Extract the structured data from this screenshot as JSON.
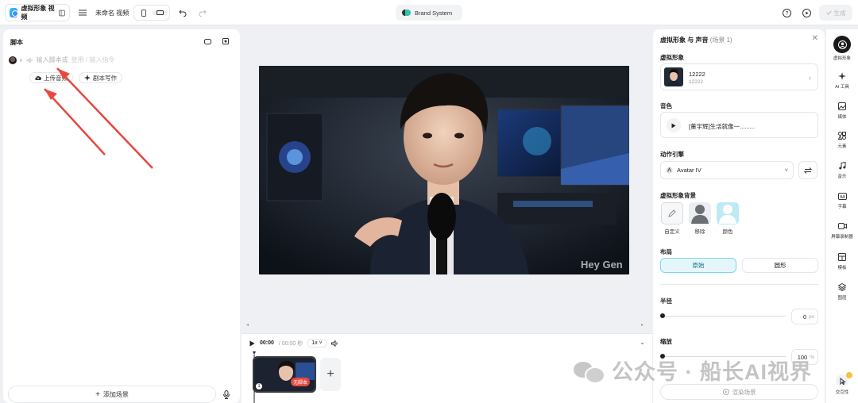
{
  "topbar": {
    "app_name": "虚拟形象 视频",
    "project_name": "未命名 视频",
    "brand_label": "Brand System",
    "publish_label": "生成"
  },
  "script": {
    "title": "脚本",
    "placeholder": "输入脚本或",
    "hint": "使用 / 输入指令",
    "upload_audio": "上传音频",
    "ai_write": "剧本写作",
    "add_scene": "添加场景"
  },
  "video": {
    "watermark": "Hey Gen"
  },
  "timeline": {
    "current_time": "00:00",
    "total_time": "/ 00:00 秒",
    "speed": "1x",
    "clip_badge": "无脚本",
    "clip_index": "1"
  },
  "panel": {
    "title": "虚拟形象 与 声音",
    "scene": "(场景 1)",
    "avatar_section": "虚拟形象",
    "avatar_name": "12222",
    "avatar_sub": "12222",
    "voice_section": "音色",
    "voice_name": "[董宇辉]生活就像一.........",
    "engine_section": "动作引擎",
    "engine_value": "Avatar IV",
    "background_section": "虚拟形象背景",
    "bg_options": [
      "自定义",
      "移除",
      "颜色"
    ],
    "layout_section": "布局",
    "layout_options": [
      "原始",
      "圆形"
    ],
    "layout_selected": "原始",
    "radius_label": "半径",
    "radius_value": "0",
    "radius_unit": "px",
    "scale_label": "缩放",
    "scale_value": "100",
    "scale_unit": "%",
    "render_label": "渲染场景"
  },
  "rail": {
    "items": [
      "虚拟形象",
      "AI 工具",
      "媒体",
      "元素",
      "音乐",
      "字幕",
      "屏幕录制器",
      "模板",
      "图层",
      "交互性"
    ]
  },
  "watermark": {
    "text": "公众号 · 船长AI视界"
  },
  "colors": {
    "accent": "#2ec6f5",
    "annotation_arrow": "#e8483f",
    "selected_layout_bg": "#e3f7fb"
  }
}
